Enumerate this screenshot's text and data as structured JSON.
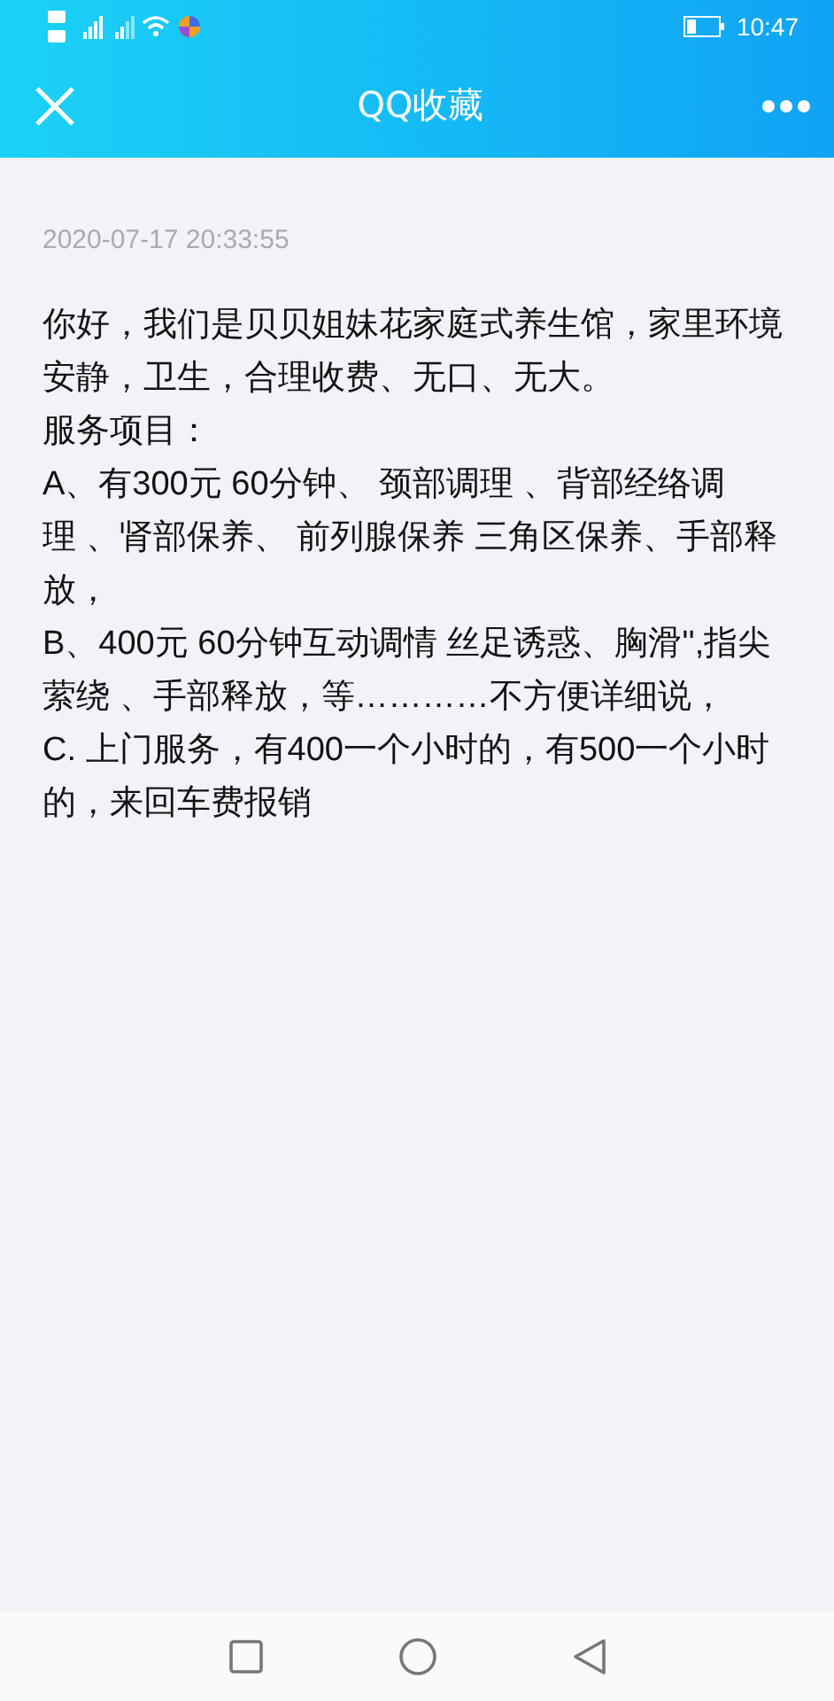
{
  "status_bar": {
    "time": "10:47"
  },
  "header": {
    "title": "QQ收藏"
  },
  "note": {
    "date": "2020-07-17 20:33:55",
    "lines": [
      "你好，我们是贝贝姐妹花家庭式养生馆，家里环境",
      "安静，卫生，合理收费、无口、无大。",
      "服务项目：",
      "A、有300元 60分钟、 颈部调理 、背部经络调",
      "理 、肾部保养、 前列腺保养 三角区保养、手部释",
      "放，",
      "B、400元 60分钟互动调情 丝足诱惑、胸滑'',指尖",
      "萦绕 、手部释放，等…………不方便详细说，",
      "C. 上门服务，有400一个小时的，有500一个小时",
      "的，来回车费报销"
    ]
  }
}
